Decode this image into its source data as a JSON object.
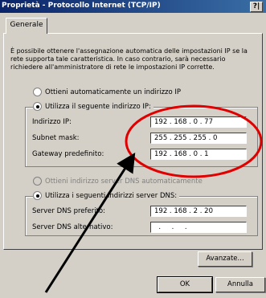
{
  "window": {
    "title": "Proprietà - Protocollo Internet (TCP/IP)",
    "help_label": "?|"
  },
  "tabs": [
    {
      "label": "Generale"
    }
  ],
  "info_text": "È possibile ottenere l'assegnazione automatica delle impostazioni IP se la rete supporta tale caratteristica. In caso contrario, sarà necessario richiedere all'amministratore di rete le impostazioni IP corrette.",
  "ip_section": {
    "auto_option_label": "Ottieni automaticamente un indirizzo IP",
    "auto_selected": false,
    "manual_option_label": "Utilizza il seguente indirizzo IP:",
    "manual_selected": true,
    "fields": [
      {
        "label": "Indirizzo IP:",
        "value": "192 . 168 . 0 . 77"
      },
      {
        "label": "Subnet mask:",
        "value": "255 . 255 . 255 . 0"
      },
      {
        "label": "Gateway predefinito:",
        "value": "192 . 168 . 0 . 1"
      }
    ]
  },
  "dns_section": {
    "auto_option_label": "Ottieni indirizzo server DNS automaticamente",
    "auto_enabled": false,
    "manual_option_label": "Utilizza i seguenti indirizzi server DNS:",
    "manual_selected": true,
    "fields": [
      {
        "label": "Server DNS preferito:",
        "value": "192 . 168 . 2 . 20"
      },
      {
        "label": "Server DNS alternativo:",
        "value": "  .     .     ."
      }
    ]
  },
  "buttons": {
    "advanced": "Avanzate...",
    "ok": "OK",
    "cancel": "Annulla"
  },
  "colors": {
    "annotation": "#e00000",
    "titlebar_start": "#0a246a",
    "titlebar_end": "#3a6ea5",
    "face": "#d4d0c8"
  }
}
